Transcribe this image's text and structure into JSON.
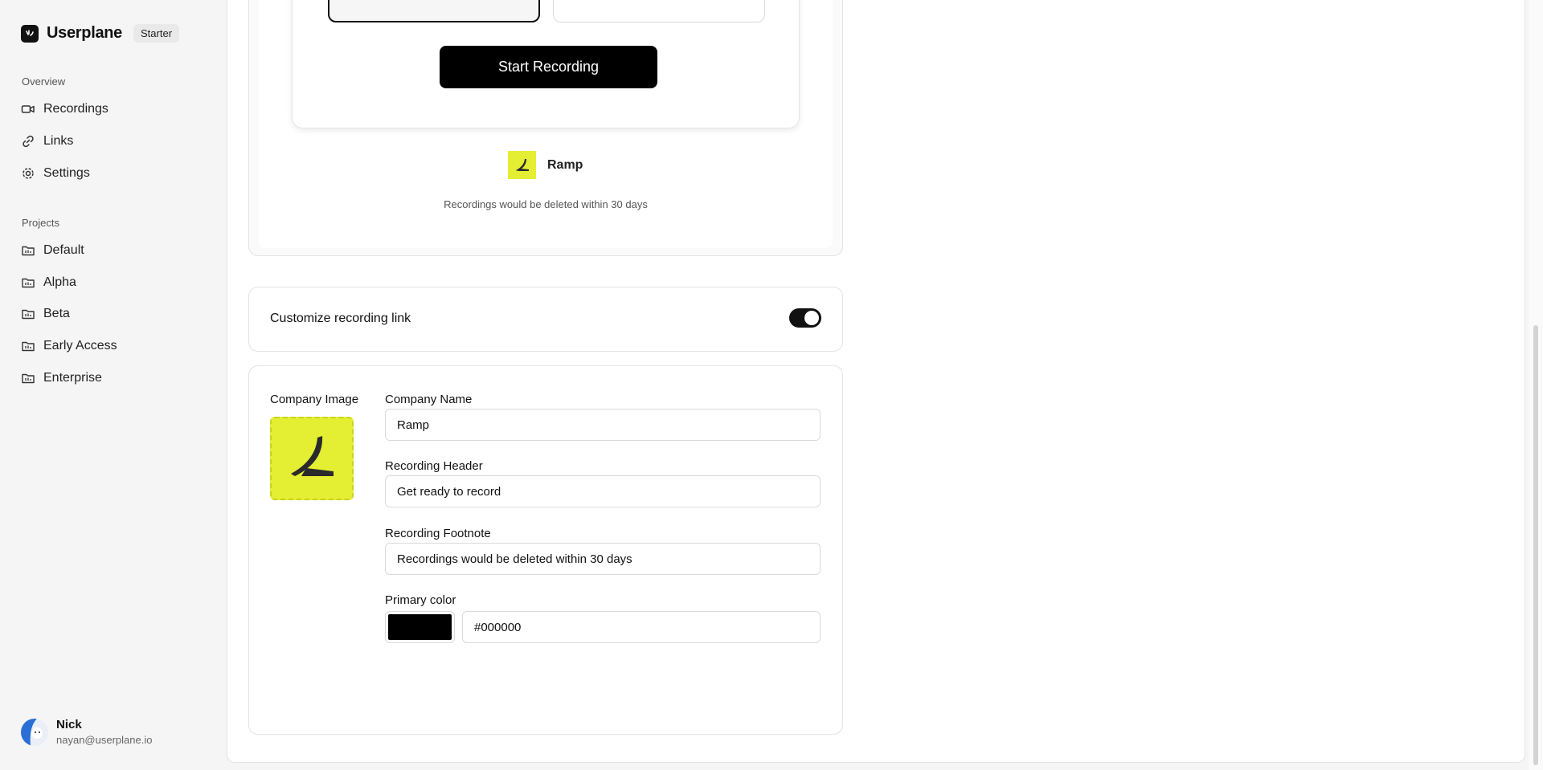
{
  "app": {
    "name": "Userplane",
    "plan": "Starter"
  },
  "sidebar": {
    "overview_label": "Overview",
    "overview_items": [
      {
        "label": "Recordings",
        "icon": "video-icon"
      },
      {
        "label": "Links",
        "icon": "link-icon"
      },
      {
        "label": "Settings",
        "icon": "gear-icon"
      }
    ],
    "projects_label": "Projects",
    "projects": [
      {
        "label": "Default",
        "icon": "folder-icon"
      },
      {
        "label": "Alpha",
        "icon": "folder-icon"
      },
      {
        "label": "Beta",
        "icon": "folder-icon"
      },
      {
        "label": "Early Access",
        "icon": "folder-icon"
      },
      {
        "label": "Enterprise",
        "icon": "folder-icon"
      }
    ],
    "user": {
      "name": "Nick",
      "email": "nayan@userplane.io"
    }
  },
  "preview": {
    "start_button": "Start Recording",
    "company_name": "Ramp",
    "footnote": "Recordings would be deleted within 30 days"
  },
  "customize": {
    "label": "Customize recording link",
    "enabled": true
  },
  "form": {
    "company_image_label": "Company Image",
    "company_name_label": "Company Name",
    "company_name_value": "Ramp",
    "header_label": "Recording Header",
    "header_value": "Get ready to record",
    "footnote_label": "Recording Footnote",
    "footnote_value": "Recordings would be deleted within 30 days",
    "color_label": "Primary color",
    "color_value": "#000000"
  },
  "colors": {
    "brand_accent": "#e4ee33",
    "primary": "#000000"
  }
}
